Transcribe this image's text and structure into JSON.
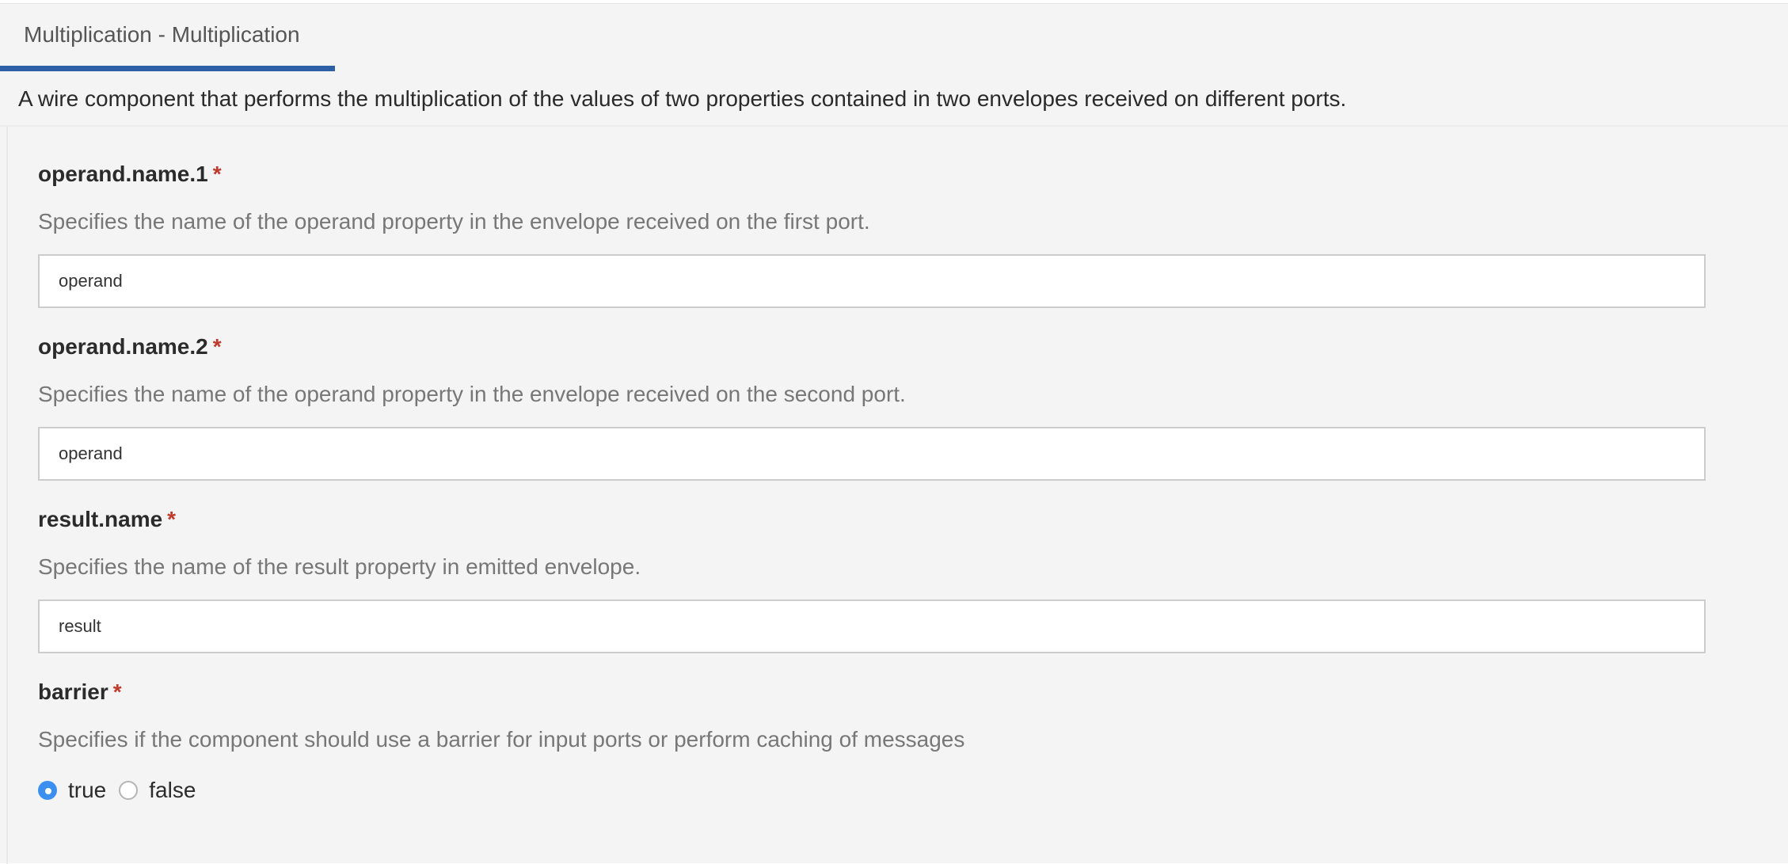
{
  "tab": {
    "label": "Multiplication - Multiplication"
  },
  "description": "A wire component that performs the multiplication of the values of two properties contained in two envelopes received on different ports.",
  "required_marker": "*",
  "fields": [
    {
      "label": "operand.name.1",
      "help": "Specifies the name of the operand property in the envelope received on the first port.",
      "value": "operand"
    },
    {
      "label": "operand.name.2",
      "help": "Specifies the name of the operand property in the envelope received on the second port.",
      "value": "operand"
    },
    {
      "label": "result.name",
      "help": "Specifies the name of the result property in emitted envelope.",
      "value": "result"
    },
    {
      "label": "barrier",
      "help": "Specifies if the component should use a barrier for input ports or perform caching of messages",
      "options": [
        {
          "label": "true",
          "selected": true
        },
        {
          "label": "false",
          "selected": false
        }
      ]
    }
  ],
  "colors": {
    "accent": "#2d5fa7",
    "radio_selected": "#3b8ff0",
    "required": "#c0392b",
    "panel_background": "#f4f4f4"
  }
}
